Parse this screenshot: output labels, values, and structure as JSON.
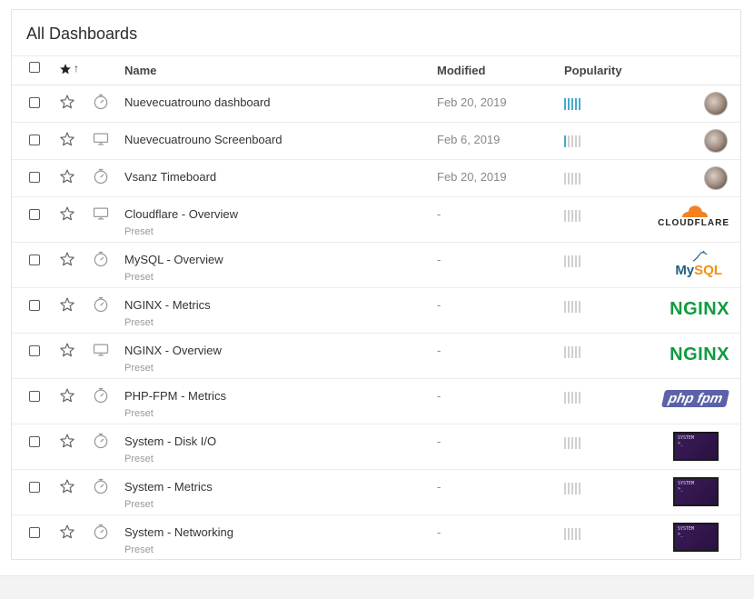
{
  "panel": {
    "title": "All Dashboards"
  },
  "columns": {
    "name": "Name",
    "modified": "Modified",
    "popularity": "Popularity",
    "sort_arrow": "↑"
  },
  "colors": {
    "popularity_on": "#47a9cc",
    "popularity_off": "#d0d0d0"
  },
  "rows": [
    {
      "name": "Nuevecuatrouno dashboard",
      "type_icon": "timeboard-icon",
      "modified": "Feb 20, 2019",
      "popularity": 5,
      "preset": "",
      "logo": "avatar"
    },
    {
      "name": "Nuevecuatrouno Screenboard",
      "type_icon": "screenboard-icon",
      "modified": "Feb 6, 2019",
      "popularity": 1,
      "preset": "",
      "logo": "avatar"
    },
    {
      "name": "Vsanz Timeboard",
      "type_icon": "timeboard-icon",
      "modified": "Feb 20, 2019",
      "popularity": 0,
      "preset": "",
      "logo": "avatar"
    },
    {
      "name": "Cloudflare - Overview",
      "type_icon": "screenboard-icon",
      "modified": "-",
      "popularity": 0,
      "preset": "Preset",
      "logo": "cloudflare",
      "logo_text": "CLOUDFLARE"
    },
    {
      "name": "MySQL - Overview",
      "type_icon": "timeboard-icon",
      "modified": "-",
      "popularity": 0,
      "preset": "Preset",
      "logo": "mysql",
      "logo_text_a": "My",
      "logo_text_b": "SQL"
    },
    {
      "name": "NGINX - Metrics",
      "type_icon": "timeboard-icon",
      "modified": "-",
      "popularity": 0,
      "preset": "Preset",
      "logo": "nginx",
      "logo_text": "NGINX"
    },
    {
      "name": "NGINX - Overview",
      "type_icon": "screenboard-icon",
      "modified": "-",
      "popularity": 0,
      "preset": "Preset",
      "logo": "nginx",
      "logo_text": "NGINX"
    },
    {
      "name": "PHP-FPM - Metrics",
      "type_icon": "timeboard-icon",
      "modified": "-",
      "popularity": 0,
      "preset": "Preset",
      "logo": "phpfpm",
      "logo_text": "php fpm"
    },
    {
      "name": "System - Disk I/O",
      "type_icon": "timeboard-icon",
      "modified": "-",
      "popularity": 0,
      "preset": "Preset",
      "logo": "system",
      "logo_text": "SYSTEM"
    },
    {
      "name": "System - Metrics",
      "type_icon": "timeboard-icon",
      "modified": "-",
      "popularity": 0,
      "preset": "Preset",
      "logo": "system",
      "logo_text": "SYSTEM"
    },
    {
      "name": "System - Networking",
      "type_icon": "timeboard-icon",
      "modified": "-",
      "popularity": 0,
      "preset": "Preset",
      "logo": "system",
      "logo_text": "SYSTEM"
    }
  ]
}
